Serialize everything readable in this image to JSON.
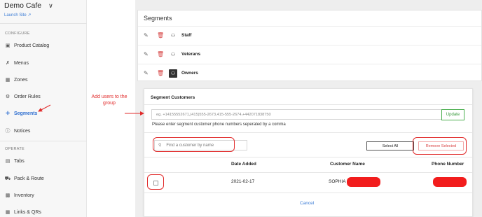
{
  "sidebar": {
    "brand": "Demo Cafe",
    "launch_site": "Launch Site",
    "configure_label": "CONFIGURE",
    "operate_label": "OPERATE",
    "items": [
      {
        "label": "Product Catalog",
        "icon": "book-icon"
      },
      {
        "label": "Menus",
        "icon": "utensils-icon"
      },
      {
        "label": "Zones",
        "icon": "zones-icon"
      },
      {
        "label": "Order Rules",
        "icon": "rules-icon"
      },
      {
        "label": "Segments",
        "icon": "segments-icon",
        "active": true
      },
      {
        "label": "Notices",
        "icon": "notice-icon"
      },
      {
        "label": "Tabs",
        "icon": "tabs-icon"
      },
      {
        "label": "Pack & Route",
        "icon": "route-icon"
      },
      {
        "label": "Inventory",
        "icon": "inventory-icon"
      },
      {
        "label": "Links & QRs",
        "icon": "qr-icon"
      }
    ]
  },
  "segments": {
    "title": "Segments",
    "rows": [
      {
        "name": "Staff"
      },
      {
        "name": "Veterans"
      },
      {
        "name": "Owners"
      }
    ]
  },
  "modal": {
    "title": "Segment Customers",
    "phone_placeholder": "eg. +14155552671,(415)555-2673,415-555-2674,+442071838750",
    "update_label": "Update",
    "helper": "Please enter segment customer phone numbers seperated by a comma",
    "search_placeholder": "Find a customer by name",
    "select_all": "Select All",
    "remove_selected": "Remove Selected",
    "columns": {
      "date": "Date Added",
      "name": "Customer Name",
      "phone": "Phone Number"
    },
    "rows": [
      {
        "date": "2021-02-17",
        "name": "SOPHIA"
      }
    ],
    "cancel": "Cancel"
  },
  "annotation": {
    "text": "Add users to the group",
    "color": "#e12b2b"
  },
  "colors": {
    "accent": "#2f6fd0",
    "danger": "#d94040",
    "success": "#3a9b3e"
  }
}
